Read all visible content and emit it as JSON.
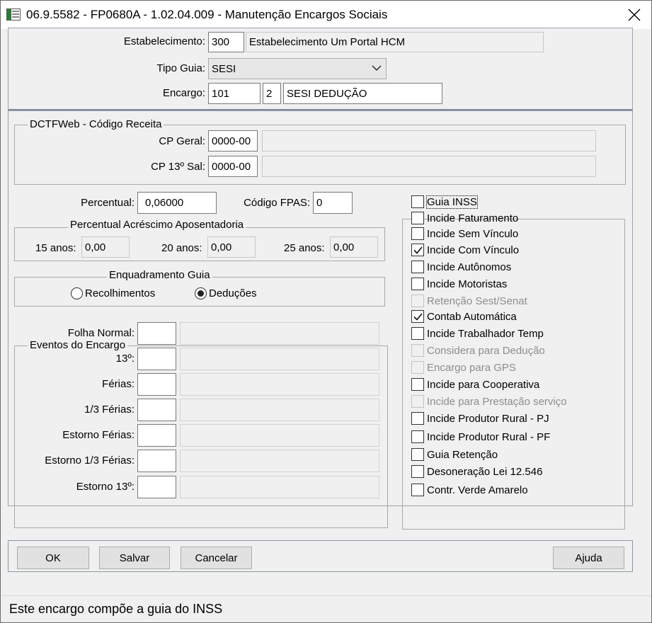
{
  "window": {
    "title": "06.9.5582 - FP0680A - 1.02.04.009 - Manutenção Encargos Sociais"
  },
  "header": {
    "estabelecimento_label": "Estabelecimento:",
    "estabelecimento_code": "300",
    "estabelecimento_name": "Estabelecimento Um Portal HCM",
    "tipo_guia_label": "Tipo Guia:",
    "tipo_guia_value": "SESI",
    "encargo_label": "Encargo:",
    "encargo_code": "101",
    "encargo_seq": "2",
    "encargo_desc": "SESI DEDUÇÃO"
  },
  "dctfweb": {
    "legend": "DCTFWeb - Código Receita",
    "cp_geral_label": "CP Geral:",
    "cp_geral_value": "0000-00",
    "cp_geral_desc": "",
    "cp_13_label": "CP 13º Sal:",
    "cp_13_value": "0000-00",
    "cp_13_desc": ""
  },
  "percentual": {
    "label": "Percentual:",
    "value": "0,06000",
    "fpas_label": "Código FPAS:",
    "fpas_value": "0"
  },
  "aposentadoria": {
    "legend": "Percentual Acréscimo Aposentadoria",
    "anos15_label": "15 anos:",
    "anos15_value": "0,00",
    "anos20_label": "20 anos:",
    "anos20_value": "0,00",
    "anos25_label": "25 anos:",
    "anos25_value": "0,00"
  },
  "enquadramento": {
    "legend": "Enquadramento Guia",
    "options": [
      {
        "label": "Recolhimentos",
        "selected": false
      },
      {
        "label": "Deduções",
        "selected": true
      }
    ]
  },
  "eventos": {
    "legend": "Eventos do Encargo",
    "rows": [
      {
        "label": "Folha Normal:",
        "code": "",
        "desc": ""
      },
      {
        "label": "13º:",
        "code": "",
        "desc": ""
      },
      {
        "label": "Férias:",
        "code": "",
        "desc": ""
      },
      {
        "label": "1/3 Férias:",
        "code": "",
        "desc": ""
      },
      {
        "label": "Estorno Férias:",
        "code": "",
        "desc": ""
      },
      {
        "label": "Estorno 1/3 Férias:",
        "code": "",
        "desc": ""
      },
      {
        "label": "Estorno 13º:",
        "code": "",
        "desc": ""
      }
    ]
  },
  "options": [
    {
      "label": "Guia INSS",
      "checked": false,
      "disabled": false,
      "focused": true,
      "icon": "checkbox-icon"
    },
    {
      "label": "Incide Faturamento",
      "checked": false,
      "disabled": false
    },
    {
      "label": "Incide Sem Vínculo",
      "checked": false,
      "disabled": false
    },
    {
      "label": "Incide Com Vínculo",
      "checked": true,
      "disabled": false
    },
    {
      "label": "Incide Autônomos",
      "checked": false,
      "disabled": false
    },
    {
      "label": "Incide Motoristas",
      "checked": false,
      "disabled": false
    },
    {
      "label": "Retenção Sest/Senat",
      "checked": false,
      "disabled": true
    },
    {
      "label": "Contab Automática",
      "checked": true,
      "disabled": false
    },
    {
      "label": "Incide Trabalhador Temp",
      "checked": false,
      "disabled": false
    },
    {
      "label": "Considera para Dedução",
      "checked": false,
      "disabled": true
    },
    {
      "label": "Encargo para GPS",
      "checked": false,
      "disabled": true
    },
    {
      "label": "Incide para Cooperativa",
      "checked": false,
      "disabled": false
    },
    {
      "label": "Incide para Prestação serviço",
      "checked": false,
      "disabled": true
    },
    {
      "label": "Incide Produtor Rural - PJ",
      "checked": false,
      "disabled": false
    },
    {
      "label": "Incide Produtor Rural - PF",
      "checked": false,
      "disabled": false
    },
    {
      "label": "Guia Retenção",
      "checked": false,
      "disabled": false
    },
    {
      "label": "Desoneração Lei 12.546",
      "checked": false,
      "disabled": false
    },
    {
      "label": "Contr. Verde Amarelo",
      "checked": false,
      "disabled": false
    }
  ],
  "buttons": {
    "ok": "OK",
    "salvar": "Salvar",
    "cancelar": "Cancelar",
    "ajuda": "Ajuda"
  },
  "status": {
    "text": "Este encargo compõe a guia do INSS"
  }
}
